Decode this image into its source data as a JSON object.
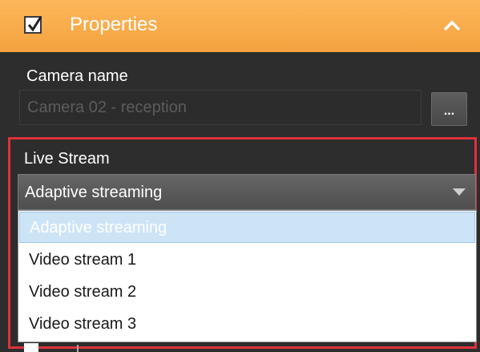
{
  "header": {
    "checked": true,
    "title": "Properties",
    "collapse_icon": "chevron-up-icon",
    "color": "#f9ad4b"
  },
  "camera": {
    "label": "Camera name",
    "value": "Camera 02 - reception",
    "browse_label": "..."
  },
  "live_stream": {
    "label": "Live Stream",
    "selected": "Adaptive streaming",
    "highlight_color": "#e0313b",
    "options": [
      "Adaptive streaming",
      "Video stream 1",
      "Video stream 2",
      "Video stream 3"
    ]
  }
}
